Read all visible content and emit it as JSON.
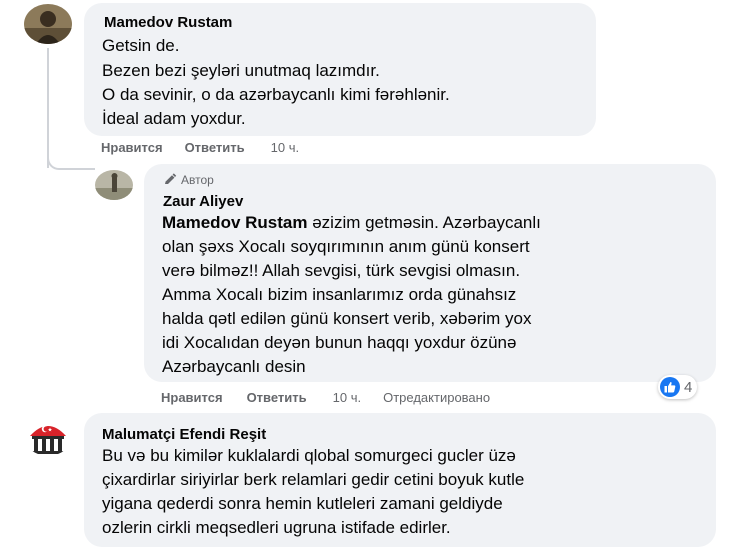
{
  "comments": [
    {
      "author": "Mamedov Rustam",
      "lines": [
        "Getsin de.",
        "Bezen bezi şeyləri unutmaq lazımdır.",
        "O da sevinir, o da azərbaycanlı kimi fərəhlənir.",
        "İdeal adam yoxdur."
      ],
      "actions": {
        "like": "Нравится",
        "reply": "Ответить",
        "time": "10 ч."
      }
    },
    {
      "badge": "Автор",
      "author": "Zaur Aliyev",
      "mention": "Mamedov Rustam",
      "first_line_rest": " əzizim getməsin. Azərbaycanlı",
      "lines": [
        "olan şəxs Xocalı soyqırımının anım günü konsert",
        "verə bilməz!! Allah sevgisi, türk sevgisi olmasın.",
        "Amma Xocalı bizim insanlarımız orda günahsız",
        "halda qətl edilən günü konsert verib, xəbərim yox",
        "idi Xocalıdan deyən bunun haqqı yoxdur özünə",
        "Azərbaycanlı desin"
      ],
      "reaction_count": "4",
      "actions": {
        "like": "Нравится",
        "reply": "Ответить",
        "time": "10 ч.",
        "edited": "Отредактировано"
      }
    },
    {
      "author": "Malumatçi Efendi Reşit",
      "lines": [
        "Bu və bu kimilər kuklalardi qlobal somurgeci gucler üzə",
        "çixardirlar siriyirlar berk relamlari gedir cetini boyuk kutle",
        "yigana qederdi sonra hemin kutleleri zamani geldiyde",
        "ozlerin cirkli meqsedleri ugruna istifade edirler."
      ]
    }
  ],
  "colors": {
    "bubble": "#f0f2f5",
    "text": "#050505",
    "secondary": "#65676b",
    "like_blue": "#1877f2"
  },
  "icons": [
    "pencil-icon",
    "thumbs-up-icon"
  ]
}
